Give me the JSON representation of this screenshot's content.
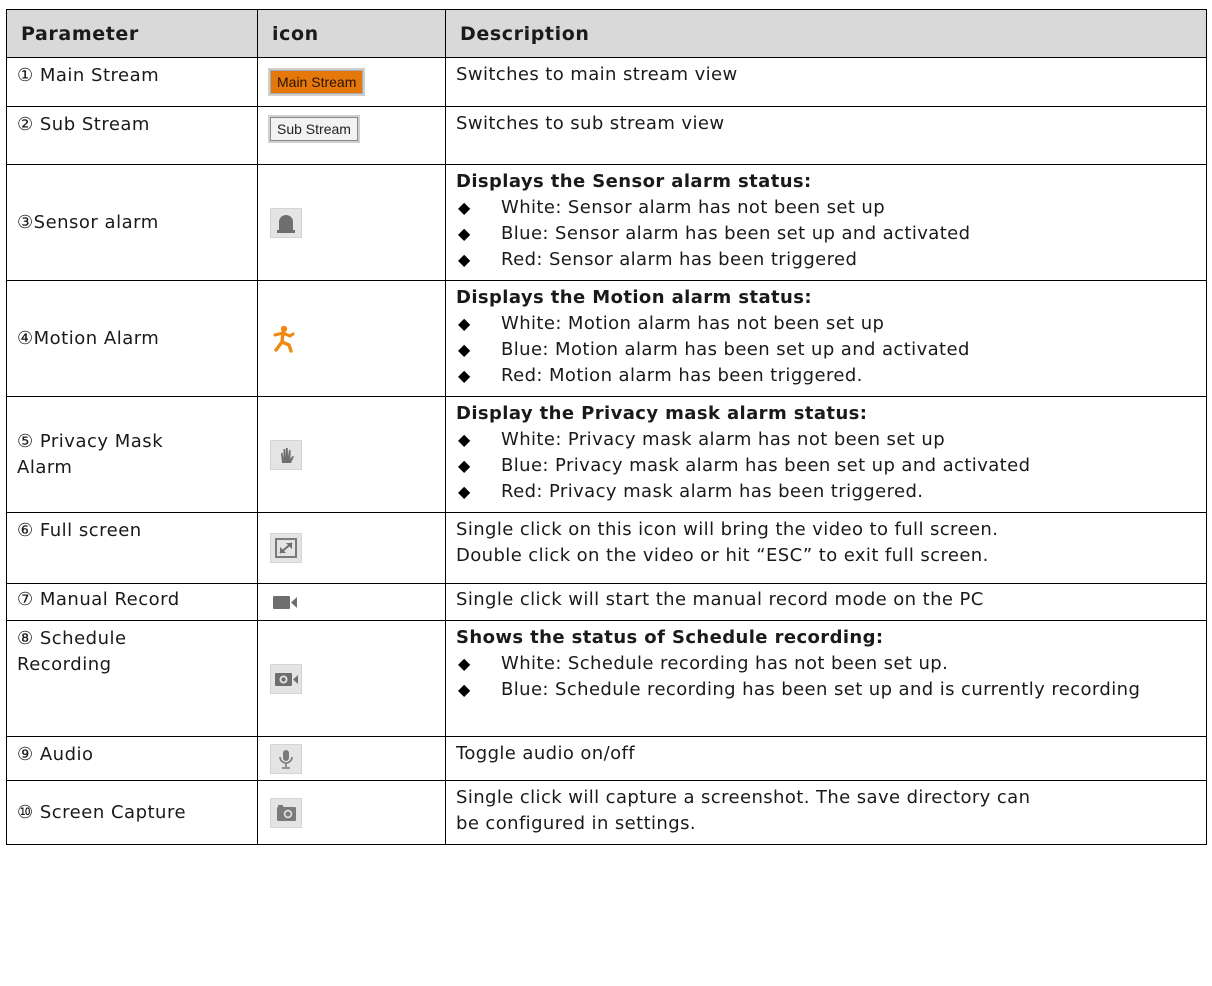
{
  "headers": {
    "parameter": "Parameter",
    "icon": "icon",
    "description": "Description"
  },
  "rows": [
    {
      "param": "① Main Stream",
      "icon_label": "Main Stream",
      "icon": "main-stream-button",
      "desc": "Switches to main stream view"
    },
    {
      "param": "② Sub Stream",
      "icon_label": "Sub Stream",
      "icon": "sub-stream-button",
      "desc": "Switches to sub stream view"
    },
    {
      "param": "③Sensor alarm",
      "icon": "siren-icon",
      "desc_head": "Displays the Sensor alarm status:",
      "bullets": [
        "White: Sensor alarm has not been set up",
        "Blue: Sensor alarm has been set up and activated",
        "Red: Sensor alarm has been triggered"
      ]
    },
    {
      "param": "④Motion Alarm",
      "icon": "running-person-icon",
      "desc_head": "Displays the Motion alarm status:",
      "bullets": [
        "White: Motion alarm has not been set up",
        "Blue: Motion alarm has been set up and activated",
        "Red: Motion alarm has been triggered."
      ]
    },
    {
      "param_line1": "⑤ Privacy Mask",
      "param_line2": "Alarm",
      "icon": "hand-icon",
      "desc_head": "Display the Privacy mask alarm status:",
      "bullets": [
        "White: Privacy mask alarm has not been set up",
        "Blue: Privacy mask alarm has been set up and activated",
        "Red: Privacy mask alarm has been triggered."
      ]
    },
    {
      "param": "⑥ Full screen",
      "icon": "fullscreen-icon",
      "desc_line1": "Single click on this icon will bring the video to full screen.",
      "desc_line2": "Double click on the video or hit “ESC” to exit full screen."
    },
    {
      "param": "⑦ Manual Record",
      "icon": "video-camera-icon",
      "desc": "Single click will start the manual record mode on the PC"
    },
    {
      "param_line1": "⑧ Schedule",
      "param_line2": "Recording",
      "icon": "schedule-camera-icon",
      "desc_head": "Shows the status of Schedule recording:",
      "bullets": [
        "White: Schedule recording has not been set up.",
        "Blue: Schedule recording has been set up and is currently recording"
      ]
    },
    {
      "param": "⑨ Audio",
      "icon": "microphone-icon",
      "desc": "Toggle audio on/off"
    },
    {
      "param": "⑩ Screen Capture",
      "icon": "camera-icon",
      "desc_line1": "Single click will capture a screenshot. The save directory can",
      "desc_line2": "be configured in settings."
    }
  ],
  "bullet_glyph": "◆",
  "colors": {
    "main_stream_bg": "#e4780b",
    "motion_icon": "#f0890f",
    "icon_gray": "#7a7a7a"
  }
}
